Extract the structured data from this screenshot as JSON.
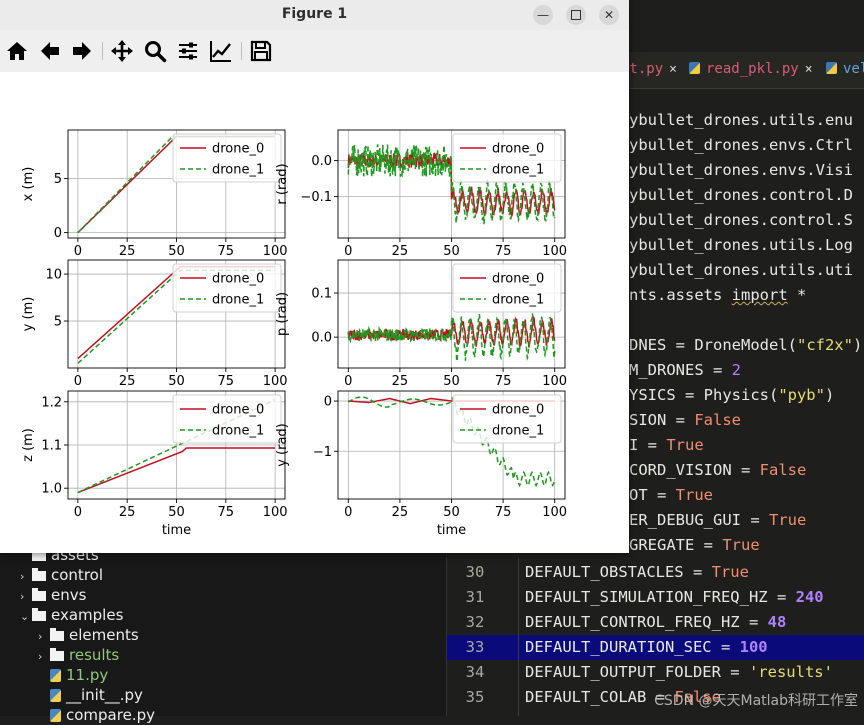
{
  "window": {
    "title": "Figure 1"
  },
  "toolbar": {
    "buttons": [
      "home-icon",
      "back-icon",
      "forward-icon",
      "pan-icon",
      "zoom-icon",
      "configure-subplots-icon",
      "edit-axes-icon",
      "save-icon"
    ]
  },
  "editor": {
    "tabs": [
      {
        "label": "st.py",
        "close": "×",
        "color": "#d95b76"
      },
      {
        "label": "read_pkl.py",
        "close": "×",
        "color": "#d95b76"
      },
      {
        "label": "vel",
        "color": "#5fa8e0"
      }
    ],
    "upper_lines": [
      "ybullet_drones.utils.enu",
      "ybullet_drones.envs.Ctrl",
      "ybullet_drones.envs.Visi",
      "ybullet_drones.control.D",
      "ybullet_drones.control.S",
      "ybullet_drones.utils.Log",
      "ybullet_drones.utils.uti"
    ],
    "import_line": {
      "pre": "nts.assets ",
      "kw": "import",
      "post": " *"
    },
    "assign_lines": [
      {
        "name": "DNES = DroneModel(",
        "val": "\"cf2x\"",
        "type": "str",
        "post": ")"
      },
      {
        "name": "M_DRONES = ",
        "val": "2",
        "type": "num",
        "post": ""
      },
      {
        "name": "YSICS = Physics(",
        "val": "\"pyb\"",
        "type": "str",
        "post": ")"
      },
      {
        "name": "SION = ",
        "val": "False",
        "type": "kw",
        "post": ""
      },
      {
        "name": "I = ",
        "val": "True",
        "type": "kw",
        "post": ""
      },
      {
        "name": "CORD_VISION = ",
        "val": "False",
        "type": "kw",
        "post": ""
      },
      {
        "name": "OT = ",
        "val": "True",
        "type": "kw",
        "post": ""
      },
      {
        "name": "ER_DEBUG_GUI = ",
        "val": "True",
        "type": "kw",
        "post": ""
      },
      {
        "name": "GREGATE = ",
        "val": "True",
        "type": "kw",
        "post": ""
      }
    ],
    "numbered_lines": [
      {
        "num": "30",
        "name": "DEFAULT_OBSTACLES = ",
        "val": "True",
        "type": "kw"
      },
      {
        "num": "31",
        "name": "DEFAULT_SIMULATION_FREQ_HZ = ",
        "val": "240",
        "type": "num"
      },
      {
        "num": "32",
        "name": "DEFAULT_CONTROL_FREQ_HZ = ",
        "val": "48",
        "type": "num"
      },
      {
        "num": "33",
        "name": "DEFAULT_DURATION_SEC = ",
        "val": "100",
        "type": "num"
      },
      {
        "num": "34",
        "name": "DEFAULT_OUTPUT_FOLDER = ",
        "val": "'results'",
        "type": "str"
      },
      {
        "num": "35",
        "name": "DEFAULT_COLAB = ",
        "val": "False",
        "type": "kw"
      }
    ],
    "file_tree": [
      {
        "label": "assets",
        "kind": "folder",
        "chev": "",
        "indent": 0
      },
      {
        "label": "control",
        "kind": "folder",
        "chev": ">",
        "indent": 0
      },
      {
        "label": "envs",
        "kind": "folder",
        "chev": ">",
        "indent": 0
      },
      {
        "label": "examples",
        "kind": "folder",
        "chev": "v",
        "indent": 0
      },
      {
        "label": "elements",
        "kind": "folder",
        "chev": ">",
        "indent": 1
      },
      {
        "label": "results",
        "kind": "folder",
        "chev": ">",
        "indent": 1,
        "green": true
      },
      {
        "label": "11.py",
        "kind": "py",
        "chev": "",
        "indent": 1,
        "green": true
      },
      {
        "label": "__init__.py",
        "kind": "py",
        "chev": "",
        "indent": 1
      },
      {
        "label": "compare.py",
        "kind": "py",
        "chev": "",
        "indent": 1
      }
    ],
    "watermark": "CSDN @天天Matlab科研工作室"
  },
  "chart_data": [
    {
      "type": "line",
      "ylabel": "x (m)",
      "xlabel": "",
      "xlim": [
        -5,
        105
      ],
      "ylim": [
        -0.5,
        9.5
      ],
      "xticks": [
        0,
        25,
        50,
        75,
        100
      ],
      "yticks": [
        0,
        5
      ],
      "grid": true,
      "legend": "top-right",
      "series": [
        {
          "name": "drone_0",
          "style": "solid",
          "color": "#c40f23",
          "x": [
            0,
            50,
            100
          ],
          "y": [
            0,
            8.9,
            8.9
          ]
        },
        {
          "name": "drone_1",
          "style": "dashed",
          "color": "#1c9a1c",
          "x": [
            0,
            48,
            100
          ],
          "y": [
            0,
            8.9,
            8.9
          ]
        }
      ]
    },
    {
      "type": "line",
      "ylabel": "r (rad)",
      "xlabel": "",
      "xlim": [
        -5,
        105
      ],
      "ylim": [
        -0.215,
        0.085
      ],
      "xticks": [
        0,
        25,
        50,
        75,
        100
      ],
      "yticks": [
        0.0,
        -0.1
      ],
      "grid": true,
      "legend": "top-right",
      "series": [
        {
          "name": "drone_0",
          "style": "solid",
          "color": "#c40f23",
          "pattern": "noise_then_osc",
          "mean1": 0.0,
          "amp1": 0.02,
          "mean2": -0.115,
          "amp2": 0.035,
          "switch": 50
        },
        {
          "name": "drone_1",
          "style": "dashed",
          "color": "#1c9a1c",
          "pattern": "noise_then_osc",
          "mean1": 0.0,
          "amp1": 0.045,
          "mean2": -0.115,
          "amp2": 0.055,
          "switch": 50
        }
      ]
    },
    {
      "type": "line",
      "ylabel": "y (m)",
      "xlabel": "",
      "xlim": [
        -5,
        105
      ],
      "ylim": [
        0,
        11.5
      ],
      "xticks": [
        0,
        25,
        50,
        75,
        100
      ],
      "yticks": [
        5,
        10
      ],
      "grid": true,
      "legend": "top-right",
      "series": [
        {
          "name": "drone_0",
          "style": "solid",
          "color": "#c40f23",
          "x": [
            0,
            52,
            100
          ],
          "y": [
            1.0,
            10.8,
            10.8
          ]
        },
        {
          "name": "drone_1",
          "style": "dashed",
          "color": "#1c9a1c",
          "x": [
            0,
            52,
            100
          ],
          "y": [
            0.5,
            10.4,
            10.4
          ]
        }
      ]
    },
    {
      "type": "line",
      "ylabel": "p (rad)",
      "xlabel": "",
      "xlim": [
        -5,
        105
      ],
      "ylim": [
        -0.07,
        0.175
      ],
      "xticks": [
        0,
        25,
        50,
        75,
        100
      ],
      "yticks": [
        0.0,
        0.1
      ],
      "grid": true,
      "legend": "top-right",
      "series": [
        {
          "name": "drone_0",
          "style": "solid",
          "color": "#c40f23",
          "pattern": "noise_then_osc",
          "mean1": 0.005,
          "amp1": 0.012,
          "mean2": 0.01,
          "amp2": 0.03,
          "switch": 50
        },
        {
          "name": "drone_1",
          "style": "dashed",
          "color": "#1c9a1c",
          "pattern": "noise_then_osc",
          "mean1": 0.005,
          "amp1": 0.015,
          "mean2": 0.0,
          "amp2": 0.045,
          "switch": 50
        }
      ]
    },
    {
      "type": "line",
      "ylabel": "z (m)",
      "xlabel": "time",
      "xlim": [
        -5,
        105
      ],
      "ylim": [
        0.975,
        1.225
      ],
      "xticks": [
        0,
        25,
        50,
        75,
        100
      ],
      "yticks": [
        1.0,
        1.1,
        1.2
      ],
      "grid": true,
      "legend": "top-right",
      "series": [
        {
          "name": "drone_0",
          "style": "solid",
          "color": "#c40f23",
          "x": [
            0,
            53,
            55,
            100
          ],
          "y": [
            0.99,
            1.085,
            1.093,
            1.093
          ]
        },
        {
          "name": "drone_1",
          "style": "dashed",
          "color": "#1c9a1c",
          "x": [
            0,
            100
          ],
          "y": [
            0.99,
            1.205
          ]
        }
      ]
    },
    {
      "type": "line",
      "ylabel": "y (rad)",
      "xlabel": "time",
      "xlim": [
        -5,
        105
      ],
      "ylim": [
        -1.95,
        0.2
      ],
      "xticks": [
        0,
        25,
        50,
        75,
        100
      ],
      "yticks": [
        0,
        -1
      ],
      "grid": true,
      "legend": "top-right",
      "series": [
        {
          "name": "drone_0",
          "style": "solid",
          "color": "#c40f23",
          "x": [
            0,
            10,
            20,
            30,
            40,
            50,
            100
          ],
          "y": [
            0,
            -0.03,
            0.05,
            -0.05,
            0.05,
            0.0,
            0.0
          ]
        },
        {
          "name": "drone_1",
          "style": "dashed",
          "color": "#1c9a1c",
          "pattern": "yaw_descent"
        }
      ]
    }
  ]
}
